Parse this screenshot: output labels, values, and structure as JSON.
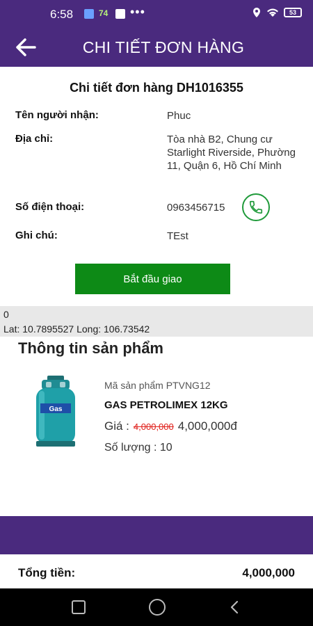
{
  "status_bar": {
    "time": "6:58",
    "notification_badge": "74",
    "more": "•••",
    "battery": "53"
  },
  "app_bar": {
    "title": "CHI TIẾT ĐƠN HÀNG",
    "back_icon": "arrow-left-icon"
  },
  "order": {
    "heading": "Chi tiết đơn hàng DH1016355",
    "recipient_label": "Tên người nhận:",
    "recipient_value": "Phuc",
    "address_label": "Địa chỉ:",
    "address_value": "Tòa nhà B2, Chung cư Starlight Riverside, Phường 11, Quận 6, Hồ Chí Minh",
    "phone_label": "Số điện thoại:",
    "phone_value": "0963456715",
    "note_label": "Ghi chú:",
    "note_value": "TEst",
    "start_button": "Bắt đầu giao"
  },
  "location": {
    "line1": "0",
    "line2": "Lat: 10.7895527 Long: 106.73542"
  },
  "products": {
    "section_title": "Thông tin sản phẩm",
    "items": [
      {
        "code": "Mã sản phẩm PTVNG12",
        "name": "GAS PETROLIMEX 12KG",
        "price_label": "Giá :",
        "old_price": "4,000,000",
        "price": "4,000,000đ",
        "quantity": "Số lượng : 10",
        "image_label": "Gas"
      }
    ]
  },
  "total": {
    "label": "Tổng tiền:",
    "value": "4,000,000"
  },
  "colors": {
    "brand": "#4a2a7e",
    "button": "#0d8a16",
    "strike": "#e0201b"
  }
}
